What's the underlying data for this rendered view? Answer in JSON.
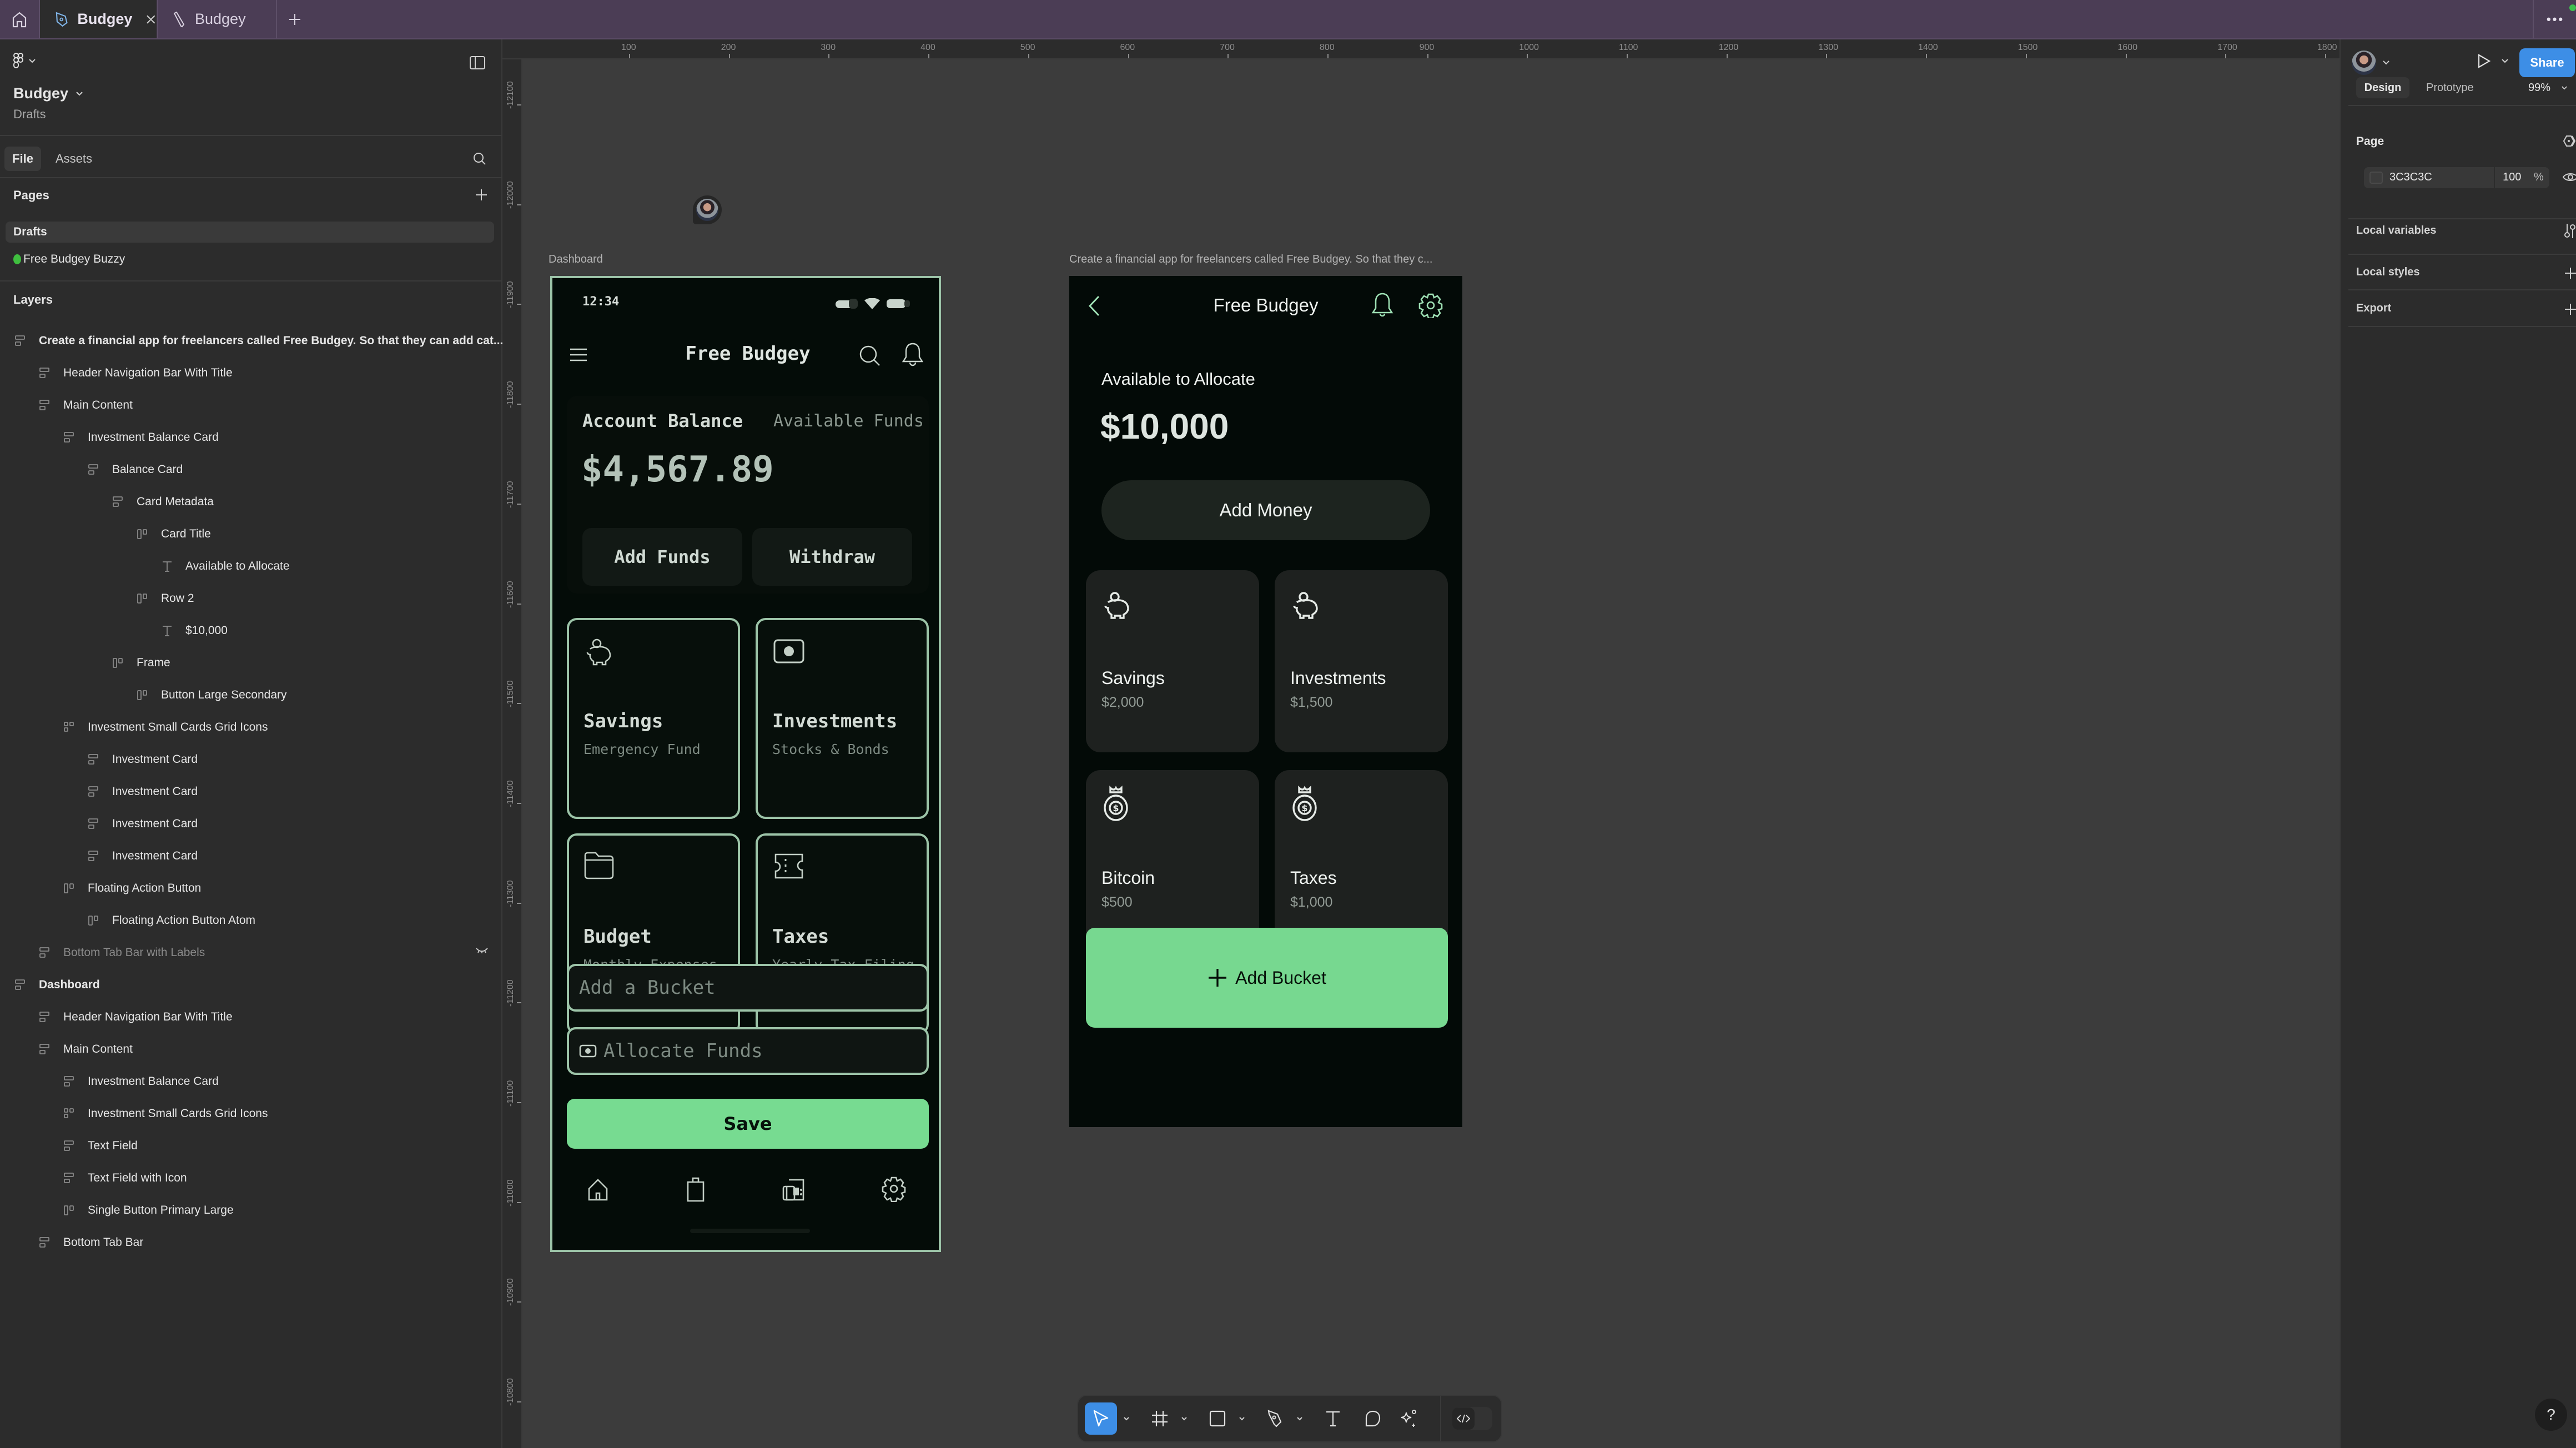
{
  "tabs": [
    {
      "label": "Budgey",
      "icon": "pen-tool-icon",
      "active": true,
      "closable": true
    },
    {
      "label": "Budgey",
      "icon": "pencil-icon",
      "active": false,
      "closable": false
    }
  ],
  "tabbar": {
    "more_label": "•••"
  },
  "left_panel": {
    "file_name": "Budgey",
    "file_location": "Drafts",
    "tabs": [
      "File",
      "Assets"
    ],
    "active_tab": "File",
    "pages_heading": "Pages",
    "pages": [
      {
        "name": "Drafts",
        "selected": true
      },
      {
        "name": "Free Budgey Buzzy",
        "selected": false,
        "status_color": "#3fbf3f"
      }
    ],
    "layers_heading": "Layers",
    "layers": [
      {
        "name": "Create a financial app for freelancers called Free Budgey. So that they can add cat...",
        "depth": 0,
        "type": "frame",
        "bold": true
      },
      {
        "name": "Header Navigation Bar With Title",
        "depth": 1,
        "type": "frame"
      },
      {
        "name": "Main Content",
        "depth": 1,
        "type": "frame"
      },
      {
        "name": "Investment Balance Card",
        "depth": 2,
        "type": "frame"
      },
      {
        "name": "Balance Card",
        "depth": 3,
        "type": "frame"
      },
      {
        "name": "Card Metadata",
        "depth": 4,
        "type": "frame"
      },
      {
        "name": "Card Title",
        "depth": 5,
        "type": "row"
      },
      {
        "name": "Available to Allocate",
        "depth": 6,
        "type": "text"
      },
      {
        "name": "Row 2",
        "depth": 5,
        "type": "row"
      },
      {
        "name": "$10,000",
        "depth": 6,
        "type": "text"
      },
      {
        "name": "Frame",
        "depth": 4,
        "type": "row"
      },
      {
        "name": "Button Large Secondary",
        "depth": 5,
        "type": "row"
      },
      {
        "name": "Investment Small Cards Grid Icons",
        "depth": 2,
        "type": "grid"
      },
      {
        "name": "Investment Card",
        "depth": 3,
        "type": "frame"
      },
      {
        "name": "Investment Card",
        "depth": 3,
        "type": "frame"
      },
      {
        "name": "Investment Card",
        "depth": 3,
        "type": "frame"
      },
      {
        "name": "Investment Card",
        "depth": 3,
        "type": "frame"
      },
      {
        "name": "Floating Action Button",
        "depth": 2,
        "type": "row"
      },
      {
        "name": "Floating Action Button Atom",
        "depth": 3,
        "type": "row"
      },
      {
        "name": "Bottom Tab Bar with Labels",
        "depth": 1,
        "type": "frame",
        "hidden": true
      },
      {
        "name": "Dashboard",
        "depth": 0,
        "type": "frame",
        "bold": true
      },
      {
        "name": "Header Navigation Bar With Title",
        "depth": 1,
        "type": "frame"
      },
      {
        "name": "Main Content",
        "depth": 1,
        "type": "frame"
      },
      {
        "name": "Investment Balance Card",
        "depth": 2,
        "type": "frame"
      },
      {
        "name": "Investment Small Cards Grid Icons",
        "depth": 2,
        "type": "grid"
      },
      {
        "name": "Text Field",
        "depth": 2,
        "type": "frame"
      },
      {
        "name": "Text Field with Icon",
        "depth": 2,
        "type": "frame"
      },
      {
        "name": "Single Button Primary Large",
        "depth": 2,
        "type": "row"
      },
      {
        "name": "Bottom Tab Bar",
        "depth": 1,
        "type": "frame"
      }
    ]
  },
  "rulers": {
    "horizontal": [
      "100",
      "200",
      "300",
      "400",
      "500",
      "600",
      "700",
      "800",
      "900",
      "1000",
      "1100",
      "1200",
      "1300",
      "1400",
      "1500",
      "1600",
      "1700",
      "1800"
    ],
    "vertical": [
      "-12100",
      "-12000",
      "-11900",
      "-11800",
      "-11700",
      "-11600",
      "-11500",
      "-11400",
      "-11300",
      "-11200",
      "-11100",
      "-11000",
      "-10900",
      "-10800"
    ]
  },
  "canvas": {
    "frame1_label": "Dashboard",
    "frame2_label": "Create a financial app for freelancers called Free Budgey. So that they c..."
  },
  "dashboard": {
    "status_time": "12:34",
    "title": "Free Budgey",
    "balance_label": "Account Balance",
    "available_label": "Available Funds",
    "balance_value": "$4,567.89",
    "add_funds_label": "Add Funds",
    "withdraw_label": "Withdraw",
    "cards": [
      {
        "title": "Savings",
        "subtitle": "Emergency Fund",
        "icon": "piggy-bank-icon"
      },
      {
        "title": "Investments",
        "subtitle": "Stocks & Bonds",
        "icon": "banknote-icon"
      },
      {
        "title": "Budget",
        "subtitle": "Monthly Expenses",
        "icon": "folder-icon"
      },
      {
        "title": "Taxes",
        "subtitle": "Yearly Tax Filing",
        "icon": "ticket-icon"
      }
    ],
    "bucket_placeholder": "Add a Bucket",
    "allocate_placeholder": "Allocate Funds",
    "save_label": "Save",
    "tabs": [
      "home-icon",
      "shopping-bag-icon",
      "wallet-icon",
      "settings-icon"
    ],
    "accent": "#77db91",
    "border": "#9cc4a8"
  },
  "allocate_screen": {
    "title": "Free Budgey",
    "available_label": "Available to Allocate",
    "available_value": "$10,000",
    "add_money_label": "Add Money",
    "buckets": [
      {
        "name": "Savings",
        "amount": "$2,000",
        "icon": "piggy-bank-icon"
      },
      {
        "name": "Investments",
        "amount": "$1,500",
        "icon": "piggy-bank-icon"
      },
      {
        "name": "Bitcoin",
        "amount": "$500",
        "icon": "money-bag-icon"
      },
      {
        "name": "Taxes",
        "amount": "$1,000",
        "icon": "money-bag-icon"
      }
    ],
    "add_bucket_label": "Add Bucket",
    "accent": "#77d890"
  },
  "right_panel": {
    "share_label": "Share",
    "tabs": [
      "Design",
      "Prototype"
    ],
    "active_tab": "Design",
    "zoom": "99%",
    "page_heading": "Page",
    "page_color": "3C3C3C",
    "page_opacity": "100",
    "percent_sign": "%",
    "local_variables": "Local variables",
    "local_styles": "Local styles",
    "export": "Export",
    "share_color": "#3d8ee6"
  },
  "toolbar": {
    "tools": [
      "move-tool",
      "frame-tool",
      "rectangle-tool",
      "pen-tool",
      "text-tool",
      "comment-tool",
      "ai-tool"
    ],
    "active_tool": "move-tool",
    "active_color": "#3d8ee6"
  },
  "help_label": "?"
}
